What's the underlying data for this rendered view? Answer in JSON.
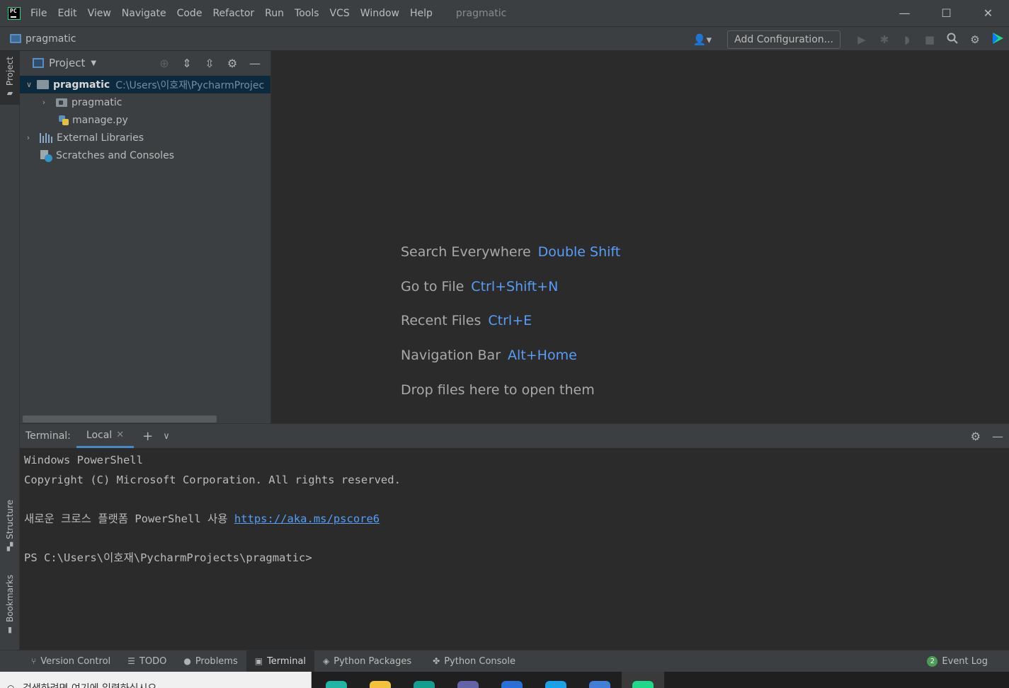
{
  "titlebar": {
    "logo_text": "PC",
    "menu": [
      "File",
      "Edit",
      "View",
      "Navigate",
      "Code",
      "Refactor",
      "Run",
      "Tools",
      "VCS",
      "Window",
      "Help"
    ],
    "window_title": "pragmatic",
    "controls": {
      "minimize": "—",
      "maximize": "☐",
      "close": "✕"
    }
  },
  "navbar": {
    "project_name": "pragmatic",
    "add_configuration": "Add Configuration...",
    "icons": [
      "user-icon",
      "run-icon",
      "debug-icon",
      "coverage-icon",
      "stop-icon",
      "search-icon",
      "settings-icon",
      "jetbrains-icon"
    ]
  },
  "left_strip": {
    "project": "Project",
    "structure": "Structure",
    "bookmarks": "Bookmarks"
  },
  "project_panel": {
    "title": "Project",
    "tree": [
      {
        "label": "pragmatic",
        "path": "C:\\Users\\이호재\\PycharmProjec",
        "type": "root-folder",
        "expanded": true
      },
      {
        "label": "pragmatic",
        "type": "package-folder",
        "expanded": false
      },
      {
        "label": "manage.py",
        "type": "python-file"
      },
      {
        "label": "External Libraries",
        "type": "libraries",
        "expanded": false
      },
      {
        "label": "Scratches and Consoles",
        "type": "scratches"
      }
    ]
  },
  "editor_hints": [
    {
      "label": "Search Everywhere",
      "key": "Double Shift"
    },
    {
      "label": "Go to File",
      "key": "Ctrl+Shift+N"
    },
    {
      "label": "Recent Files",
      "key": "Ctrl+E"
    },
    {
      "label": "Navigation Bar",
      "key": "Alt+Home"
    },
    {
      "label": "Drop files here to open them",
      "key": ""
    }
  ],
  "terminal": {
    "label": "Terminal:",
    "tab": "Local",
    "lines": {
      "l1": "Windows PowerShell",
      "l2": "Copyright (C) Microsoft Corporation. All rights reserved.",
      "l3_prefix": "새로운 크로스 플랫폼 PowerShell 사용 ",
      "l3_link": "https://aka.ms/pscore6",
      "l4": "PS C:\\Users\\이호재\\PycharmProjects\\pragmatic>"
    }
  },
  "bottom_tabs": [
    {
      "label": "Version Control",
      "icon": "branch-icon"
    },
    {
      "label": "TODO",
      "icon": "list-icon"
    },
    {
      "label": "Problems",
      "icon": "warning-icon"
    },
    {
      "label": "Terminal",
      "icon": "terminal-icon",
      "selected": true
    },
    {
      "label": "Python Packages",
      "icon": "layers-icon"
    },
    {
      "label": "Python Console",
      "icon": "python-icon"
    }
  ],
  "event_log": {
    "count": "2",
    "label": "Event Log"
  },
  "taskbar": {
    "search_text": "검색하려면 여기에 입력하십시오"
  },
  "colors": {
    "accent": "#589df6",
    "selection": "#0d293e",
    "tab_underline": "#4a88c7"
  }
}
